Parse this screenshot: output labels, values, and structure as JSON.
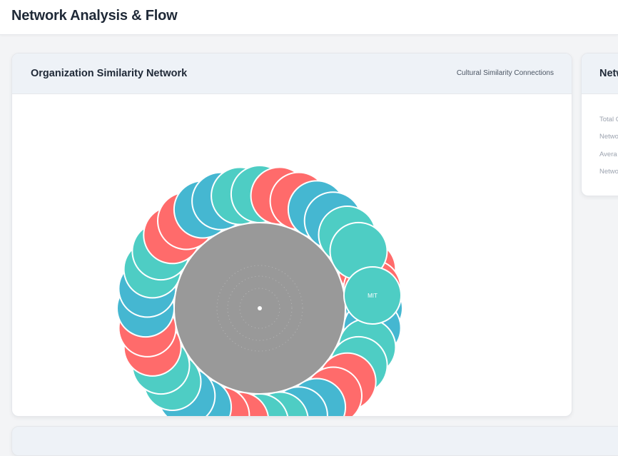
{
  "header": {
    "title": "Network Analysis & Flow"
  },
  "network_card": {
    "title": "Organization Similarity Network",
    "subtitle": "Cultural Similarity Connections",
    "highlighted_node": {
      "label": "MIT",
      "color": "#4ecdc4"
    },
    "node_colors": [
      "#ff6b6b",
      "#45b7d1",
      "#4ecdc4"
    ],
    "center_color": "#999999"
  },
  "side_card": {
    "title": "Netw",
    "stats": [
      "Total C",
      "Netwo",
      "Avera",
      "Netwo"
    ]
  }
}
